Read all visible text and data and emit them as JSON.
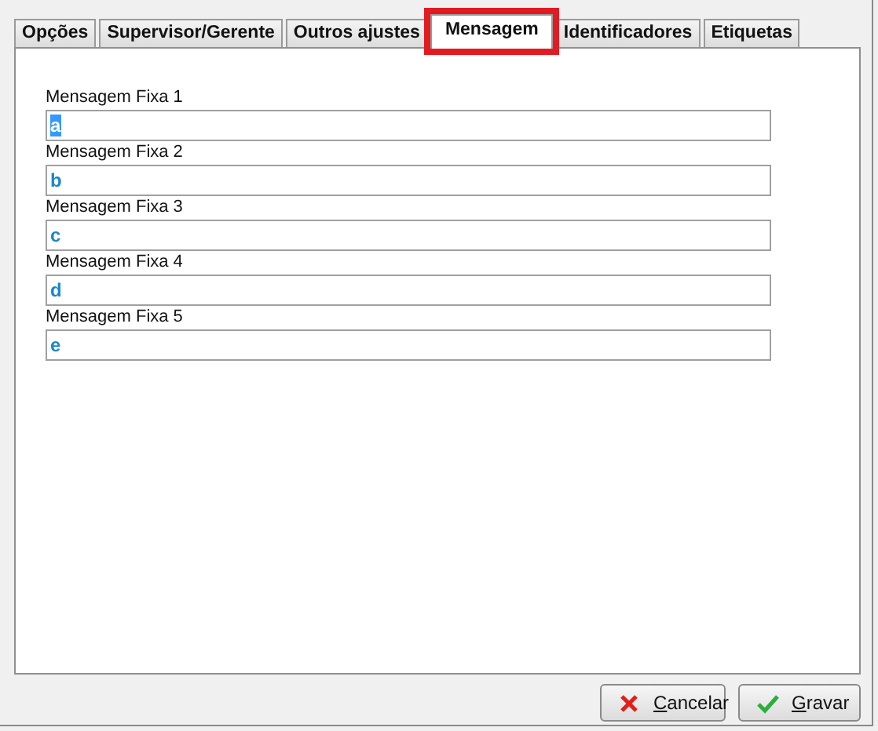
{
  "tabs": [
    {
      "label": "Opções",
      "selected": false,
      "highlighted": false
    },
    {
      "label": "Supervisor/Gerente",
      "selected": false,
      "highlighted": false
    },
    {
      "label": "Outros ajustes",
      "selected": false,
      "highlighted": false
    },
    {
      "label": "Mensagem",
      "selected": true,
      "highlighted": true
    },
    {
      "label": "Identificadores",
      "selected": false,
      "highlighted": false
    },
    {
      "label": "Etiquetas",
      "selected": false,
      "highlighted": false
    }
  ],
  "fields": [
    {
      "label": "Mensagem Fixa 1",
      "value": "a",
      "text_selected": true
    },
    {
      "label": "Mensagem Fixa 2",
      "value": "b",
      "text_selected": false
    },
    {
      "label": "Mensagem Fixa 3",
      "value": "c",
      "text_selected": false
    },
    {
      "label": "Mensagem Fixa 4",
      "value": "d",
      "text_selected": false
    },
    {
      "label": "Mensagem Fixa 5",
      "value": "e",
      "text_selected": false
    }
  ],
  "buttons": [
    {
      "label": "Cancelar",
      "kind": "cancel"
    },
    {
      "label": "Gravar",
      "kind": "save"
    }
  ]
}
